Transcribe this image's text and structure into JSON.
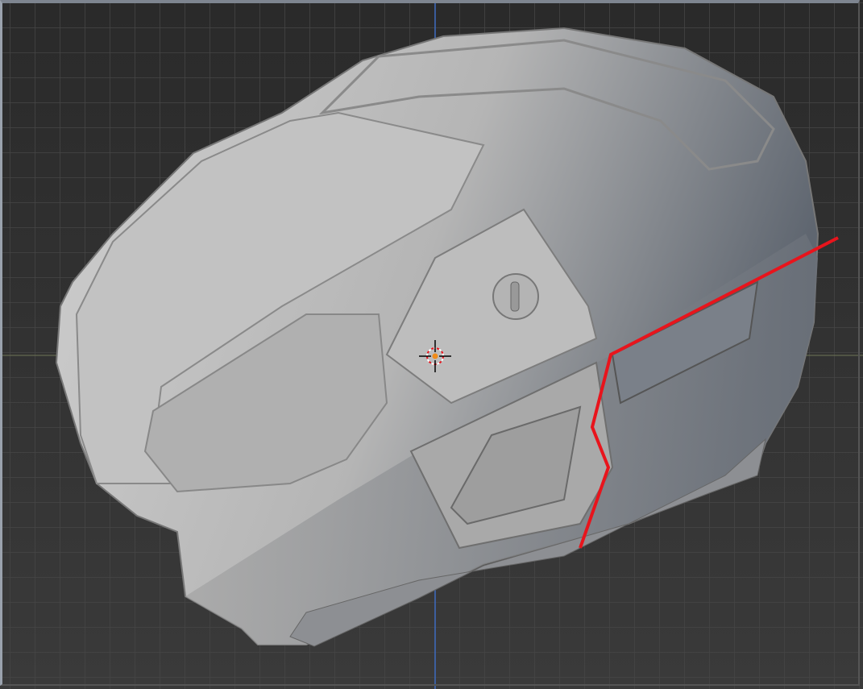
{
  "viewport": {
    "grid_color": "#454545",
    "z_axis_color": "#3d6bbf",
    "x_axis_color": "#6e7555",
    "annotation_color": "#e8141c",
    "model_color": "#b9b9b9"
  }
}
